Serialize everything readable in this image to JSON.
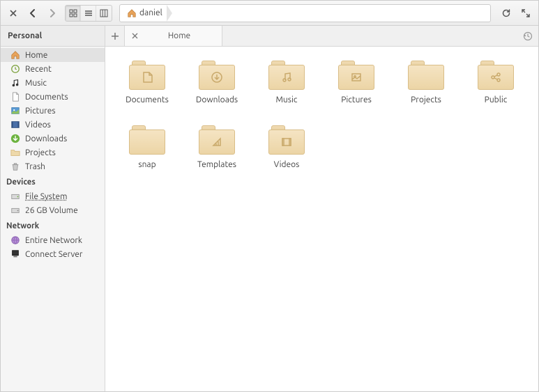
{
  "pathbar": {
    "crumb_label": "daniel"
  },
  "sidebar": {
    "header_personal": "Personal",
    "header_devices": "Devices",
    "header_network": "Network",
    "personal": [
      {
        "label": "Home"
      },
      {
        "label": "Recent"
      },
      {
        "label": "Music"
      },
      {
        "label": "Documents"
      },
      {
        "label": "Pictures"
      },
      {
        "label": "Videos"
      },
      {
        "label": "Downloads"
      },
      {
        "label": "Projects"
      },
      {
        "label": "Trash"
      }
    ],
    "devices": [
      {
        "label": "File System"
      },
      {
        "label": "26 GB Volume"
      }
    ],
    "network": [
      {
        "label": "Entire Network"
      },
      {
        "label": "Connect Server"
      }
    ]
  },
  "tab": {
    "label": "Home"
  },
  "items": [
    {
      "label": "Documents",
      "icon": "doc"
    },
    {
      "label": "Downloads",
      "icon": "download"
    },
    {
      "label": "Music",
      "icon": "music"
    },
    {
      "label": "Pictures",
      "icon": "picture"
    },
    {
      "label": "Projects",
      "icon": "plain"
    },
    {
      "label": "Public",
      "icon": "share"
    },
    {
      "label": "snap",
      "icon": "plain"
    },
    {
      "label": "Templates",
      "icon": "template"
    },
    {
      "label": "Videos",
      "icon": "video"
    }
  ]
}
